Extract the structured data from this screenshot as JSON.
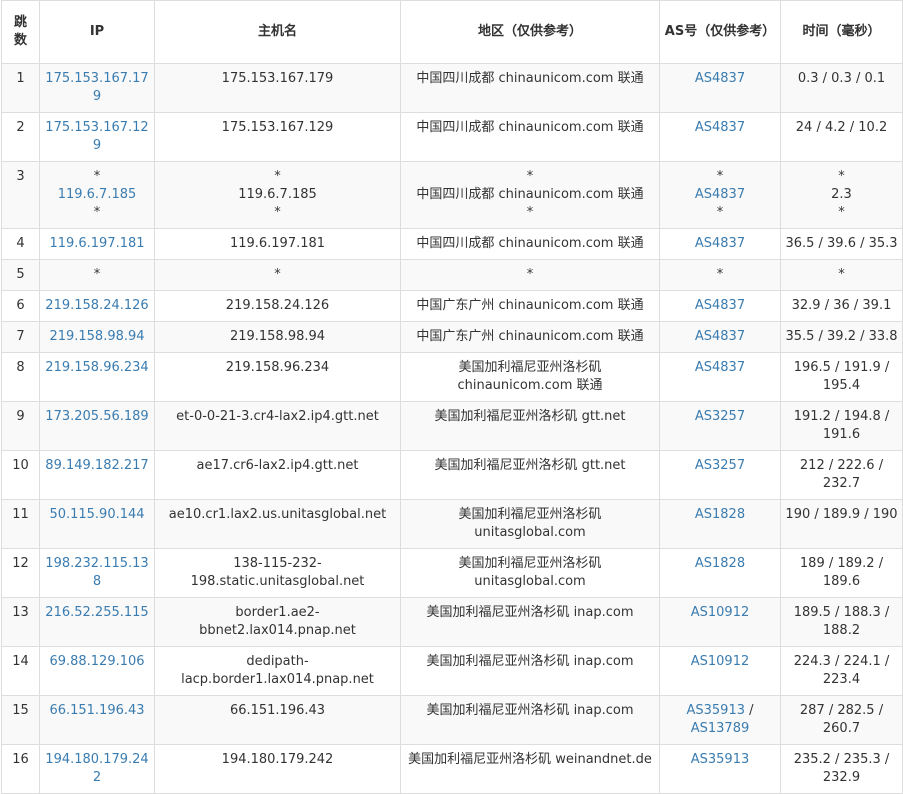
{
  "headers": {
    "hop": "跳数",
    "ip": "IP",
    "hostname": "主机名",
    "region": "地区（仅供参考）",
    "as": "AS号（仅供参考）",
    "time": "时间（毫秒）"
  },
  "rows": [
    {
      "hop": "1",
      "ip": [
        "175.153.167.179"
      ],
      "host": [
        "175.153.167.179"
      ],
      "region": [
        "中国四川成都 chinaunicom.com 联通"
      ],
      "as": [
        [
          "AS4837"
        ]
      ],
      "time": [
        "0.3 / 0.3 / 0.1"
      ]
    },
    {
      "hop": "2",
      "ip": [
        "175.153.167.129"
      ],
      "host": [
        "175.153.167.129"
      ],
      "region": [
        "中国四川成都 chinaunicom.com 联通"
      ],
      "as": [
        [
          "AS4837"
        ]
      ],
      "time": [
        "24 / 4.2 / 10.2"
      ]
    },
    {
      "hop": "3",
      "ip": [
        "*",
        "119.6.7.185",
        "*"
      ],
      "host": [
        "*",
        "119.6.7.185",
        "*"
      ],
      "region": [
        "*",
        "中国四川成都 chinaunicom.com 联通",
        "*"
      ],
      "as": [
        [
          "*"
        ],
        [
          "AS4837"
        ],
        [
          "*"
        ]
      ],
      "time": [
        "*",
        "2.3",
        "*"
      ]
    },
    {
      "hop": "4",
      "ip": [
        "119.6.197.181"
      ],
      "host": [
        "119.6.197.181"
      ],
      "region": [
        "中国四川成都 chinaunicom.com 联通"
      ],
      "as": [
        [
          "AS4837"
        ]
      ],
      "time": [
        "36.5 / 39.6 / 35.3"
      ]
    },
    {
      "hop": "5",
      "ip": [
        "*"
      ],
      "host": [
        "*"
      ],
      "region": [
        "*"
      ],
      "as": [
        [
          "*"
        ]
      ],
      "time": [
        "*"
      ]
    },
    {
      "hop": "6",
      "ip": [
        "219.158.24.126"
      ],
      "host": [
        "219.158.24.126"
      ],
      "region": [
        "中国广东广州 chinaunicom.com 联通"
      ],
      "as": [
        [
          "AS4837"
        ]
      ],
      "time": [
        "32.9 / 36 / 39.1"
      ]
    },
    {
      "hop": "7",
      "ip": [
        "219.158.98.94"
      ],
      "host": [
        "219.158.98.94"
      ],
      "region": [
        "中国广东广州 chinaunicom.com 联通"
      ],
      "as": [
        [
          "AS4837"
        ]
      ],
      "time": [
        "35.5 / 39.2 / 33.8"
      ]
    },
    {
      "hop": "8",
      "ip": [
        "219.158.96.234"
      ],
      "host": [
        "219.158.96.234"
      ],
      "region": [
        "美国加利福尼亚州洛杉矶",
        "chinaunicom.com 联通"
      ],
      "as": [
        [
          "AS4837"
        ]
      ],
      "time": [
        "196.5 / 191.9 /",
        "195.4"
      ]
    },
    {
      "hop": "9",
      "ip": [
        "173.205.56.189"
      ],
      "host": [
        "et-0-0-21-3.cr4-lax2.ip4.gtt.net"
      ],
      "region": [
        "美国加利福尼亚州洛杉矶 gtt.net"
      ],
      "as": [
        [
          "AS3257"
        ]
      ],
      "time": [
        "191.2 / 194.8 /",
        "191.6"
      ]
    },
    {
      "hop": "10",
      "ip": [
        "89.149.182.217"
      ],
      "host": [
        "ae17.cr6-lax2.ip4.gtt.net"
      ],
      "region": [
        "美国加利福尼亚州洛杉矶 gtt.net"
      ],
      "as": [
        [
          "AS3257"
        ]
      ],
      "time": [
        "212 / 222.6 /",
        "232.7"
      ]
    },
    {
      "hop": "11",
      "ip": [
        "50.115.90.144"
      ],
      "host": [
        "ae10.cr1.lax2.us.unitasglobal.net"
      ],
      "region": [
        "美国加利福尼亚州洛杉矶",
        "unitasglobal.com"
      ],
      "as": [
        [
          "AS1828"
        ]
      ],
      "time": [
        "190 / 189.9 / 190"
      ]
    },
    {
      "hop": "12",
      "ip": [
        "198.232.115.138"
      ],
      "host": [
        "138-115-232-",
        "198.static.unitasglobal.net"
      ],
      "region": [
        "美国加利福尼亚州洛杉矶",
        "unitasglobal.com"
      ],
      "as": [
        [
          "AS1828"
        ]
      ],
      "time": [
        "189 / 189.2 /",
        "189.6"
      ]
    },
    {
      "hop": "13",
      "ip": [
        "216.52.255.115"
      ],
      "host": [
        "border1.ae2-bbnet2.lax014.pnap.net"
      ],
      "region": [
        "美国加利福尼亚州洛杉矶 inap.com"
      ],
      "as": [
        [
          "AS10912"
        ]
      ],
      "time": [
        "189.5 / 188.3 /",
        "188.2"
      ]
    },
    {
      "hop": "14",
      "ip": [
        "69.88.129.106"
      ],
      "host": [
        "dedipath-",
        "lacp.border1.lax014.pnap.net"
      ],
      "region": [
        "美国加利福尼亚州洛杉矶 inap.com"
      ],
      "as": [
        [
          "AS10912"
        ]
      ],
      "time": [
        "224.3 / 224.1 /",
        "223.4"
      ]
    },
    {
      "hop": "15",
      "ip": [
        "66.151.196.43"
      ],
      "host": [
        "66.151.196.43"
      ],
      "region": [
        "美国加利福尼亚州洛杉矶 inap.com"
      ],
      "as": [
        [
          "AS35913",
          "AS13789"
        ]
      ],
      "time": [
        "287 / 282.5 /",
        "260.7"
      ]
    },
    {
      "hop": "16",
      "ip": [
        "194.180.179.242"
      ],
      "host": [
        "194.180.179.242"
      ],
      "region": [
        "美国加利福尼亚州洛杉矶 weinandnet.de"
      ],
      "as": [
        [
          "AS35913"
        ]
      ],
      "time": [
        "235.2 / 235.3 /",
        "232.9"
      ]
    }
  ],
  "colors": {
    "link": "#3a7cb0",
    "border": "#dddddd",
    "stripe": "#f9f9f9"
  }
}
